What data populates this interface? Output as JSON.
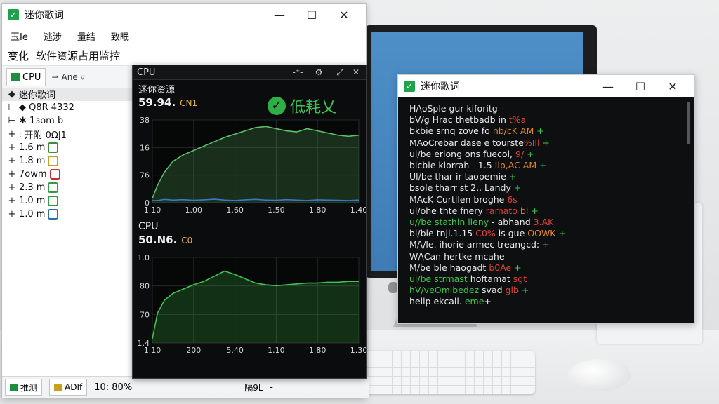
{
  "window_main": {
    "title": "迷你歌词",
    "menu": [
      "玉Ie",
      "逃涉",
      "量结",
      "致眠"
    ],
    "sub_title": "软件资源占用监控",
    "sub_prefix": "变化",
    "toolbar": {
      "cpu_label": "CPU",
      "filter_label": "Ane"
    },
    "tree": [
      {
        "lead": "◆",
        "text": "迷你歌词",
        "badge": "",
        "selected": true
      },
      {
        "lead": "⊢",
        "text": "◆ Q8R 4332",
        "badge": ""
      },
      {
        "lead": "⊢",
        "text": "✱ 1зom b",
        "badge": ""
      },
      {
        "lead": "+",
        "text": "∶ 开附 0ΩJ1",
        "badge": ""
      },
      {
        "lead": "+",
        "text": "1.6 m",
        "badge": "#3a8f3a"
      },
      {
        "lead": "+",
        "text": "1.8 m",
        "badge": "#c8a020"
      },
      {
        "lead": "+",
        "text": "7owm",
        "badge": "#c03030"
      },
      {
        "lead": "+",
        "text": "2.3 m",
        "badge": "#2e9d44"
      },
      {
        "lead": "+",
        "text": "1.0 m",
        "badge": "#2e9d44"
      },
      {
        "lead": "+",
        "text": "1.0 m",
        "badge": "#2a70a8"
      }
    ],
    "status": {
      "btn1": "推测",
      "btn2": "ADIf",
      "value": "10: 80%",
      "right": "隔9L"
    }
  },
  "cpu_panel": {
    "title": "CPU",
    "section1_label": "迷你资源",
    "section1_value": "59.94.",
    "section1_unit": "CN1",
    "badge_text": "低耗乂",
    "section2_label": "CPU",
    "section2_value": "50.N6.",
    "section2_unit": "C0"
  },
  "chart_data": [
    {
      "type": "area",
      "x_ticks": [
        "1.10",
        "1.00",
        "1.60",
        "1.50",
        "1.80",
        "1.40"
      ],
      "y_ticks": [
        "0",
        "76",
        "16",
        "38"
      ],
      "x": [
        0,
        0.3,
        0.7,
        1.2,
        1.8,
        2.4,
        3.0,
        3.6,
        4.2,
        4.8,
        5.4,
        6.0,
        6.6,
        7.2,
        7.8,
        8.4,
        9.0,
        9.6,
        10.2,
        10.8,
        11.4,
        12
      ],
      "series": [
        {
          "values": [
            2,
            8,
            14,
            19,
            22,
            24,
            26,
            28,
            30,
            31.5,
            33,
            34.5,
            35,
            34,
            33,
            32.5,
            34,
            33,
            32,
            31,
            30.5,
            31
          ],
          "color": "#5fbf6a"
        },
        {
          "values": [
            1,
            1,
            1.5,
            1.2,
            1.4,
            1.1,
            1.3,
            1.6,
            1.2,
            1.0,
            1.3,
            1.5,
            1.2,
            1.1,
            1.4,
            1.2,
            1.0,
            1.3,
            1.2,
            1.1,
            1.0,
            1.2
          ],
          "color": "#3a78c8"
        }
      ],
      "ylim": [
        0,
        38
      ],
      "grid": true
    },
    {
      "type": "area",
      "x_ticks": [
        "1.10",
        "200",
        "5.40",
        "1.10",
        "1.80",
        "1.30"
      ],
      "y_ticks": [
        "1.4",
        "70",
        "80",
        "1.0"
      ],
      "x": [
        0,
        0.3,
        0.7,
        1.2,
        1.8,
        2.4,
        3.0,
        3.6,
        4.2,
        4.8,
        5.4,
        6.0,
        6.6,
        7.2,
        7.8,
        8.4,
        9.0,
        9.6,
        10.2,
        10.8,
        11.4,
        12
      ],
      "series": [
        {
          "values": [
            0.5,
            3.5,
            5.0,
            5.8,
            6.3,
            6.8,
            7.2,
            7.8,
            8.4,
            8.0,
            7.5,
            7.0,
            6.8,
            6.7,
            6.8,
            6.9,
            7.0,
            7.0,
            7.1,
            7.1,
            7.2,
            7.2
          ],
          "color": "#3fc24e"
        }
      ],
      "ylim": [
        0,
        10
      ],
      "grid": true
    }
  ],
  "window_lyrics": {
    "title": "迷你歌词",
    "lines": [
      [
        {
          "t": "H/\\oSple gur kiforitg",
          "c": "w"
        }
      ],
      [
        {
          "t": "bV/g Hrac thetbadb in ",
          "c": "w"
        },
        {
          "t": "t%a",
          "c": "rd"
        }
      ],
      [
        {
          "t": "bkbie srnq zove fo ",
          "c": "w"
        },
        {
          "t": "nb/cK AM",
          "c": "or"
        },
        {
          "t": " +",
          "c": "gr"
        }
      ],
      [
        {
          "t": "MAoCrebar dase e tourste",
          "c": "w"
        },
        {
          "t": "%Ill",
          "c": "rd"
        },
        {
          "t": " +",
          "c": "gr"
        }
      ],
      [
        {
          "t": "ul/be erlong ons fuecol,",
          "c": "w"
        },
        {
          "t": " 9/",
          "c": "rd"
        },
        {
          "t": " +",
          "c": "gr"
        }
      ],
      [
        {
          "t": "blcbie kiorrah - 1.5 ",
          "c": "w"
        },
        {
          "t": "Ilp,AC AM",
          "c": "or"
        },
        {
          "t": " +",
          "c": "gr"
        }
      ],
      [
        {
          "t": "Ul/be thar ir taopemie",
          "c": "w"
        },
        {
          "t": " +",
          "c": "gr"
        }
      ],
      [
        {
          "t": "bsole tharr st 2,, Landy",
          "c": "w"
        },
        {
          "t": " +",
          "c": "gr"
        }
      ],
      [
        {
          "t": "MAcK Curtllen broghe ",
          "c": "w"
        },
        {
          "t": "6s",
          "c": "rd"
        }
      ],
      [
        {
          "t": "ul/ohe thte fnery ",
          "c": "w"
        },
        {
          "t": "ramato ",
          "c": "rd"
        },
        {
          "t": "bl",
          "c": "or"
        },
        {
          "t": " +",
          "c": "gr"
        }
      ],
      [
        {
          "t": "u//be stathin lieny ",
          "c": "gr"
        },
        {
          "t": "- abhand",
          "c": "w"
        },
        {
          "t": " 3.AK",
          "c": "rd"
        }
      ],
      [
        {
          "t": "bl/bie tnjl.1.15 ",
          "c": "w"
        },
        {
          "t": "C0%",
          "c": "rd"
        },
        {
          "t": " is gue",
          "c": "w"
        },
        {
          "t": " OOWK",
          "c": "or"
        },
        {
          "t": " +",
          "c": "gr"
        }
      ],
      [
        {
          "t": "M/\\/le. ihorie armec treangcd:",
          "c": "w"
        },
        {
          "t": " +",
          "c": "gr"
        }
      ],
      [
        {
          "t": "W/\\Can hertke ",
          "c": "w"
        },
        {
          "t": "mcahe",
          "c": "w"
        }
      ],
      [
        {
          "t": "M/be ble haogadt ",
          "c": "w"
        },
        {
          "t": "b0Ae",
          "c": "rd"
        },
        {
          "t": " +",
          "c": "gr"
        }
      ],
      [
        {
          "t": "ul/be strmast ",
          "c": "gr"
        },
        {
          "t": "hoftamat ",
          "c": "w"
        },
        {
          "t": "sgt",
          "c": "rd"
        }
      ],
      [
        {
          "t": "hV/veOmlbedez ",
          "c": "gr"
        },
        {
          "t": "svad ",
          "c": "w"
        },
        {
          "t": "gib",
          "c": "rd"
        },
        {
          "t": " +",
          "c": "gr"
        }
      ],
      [
        {
          "t": "hellp ekcall. ",
          "c": "w"
        },
        {
          "t": "eme",
          "c": "gr"
        },
        {
          "t": "+",
          "c": "w"
        }
      ]
    ]
  }
}
